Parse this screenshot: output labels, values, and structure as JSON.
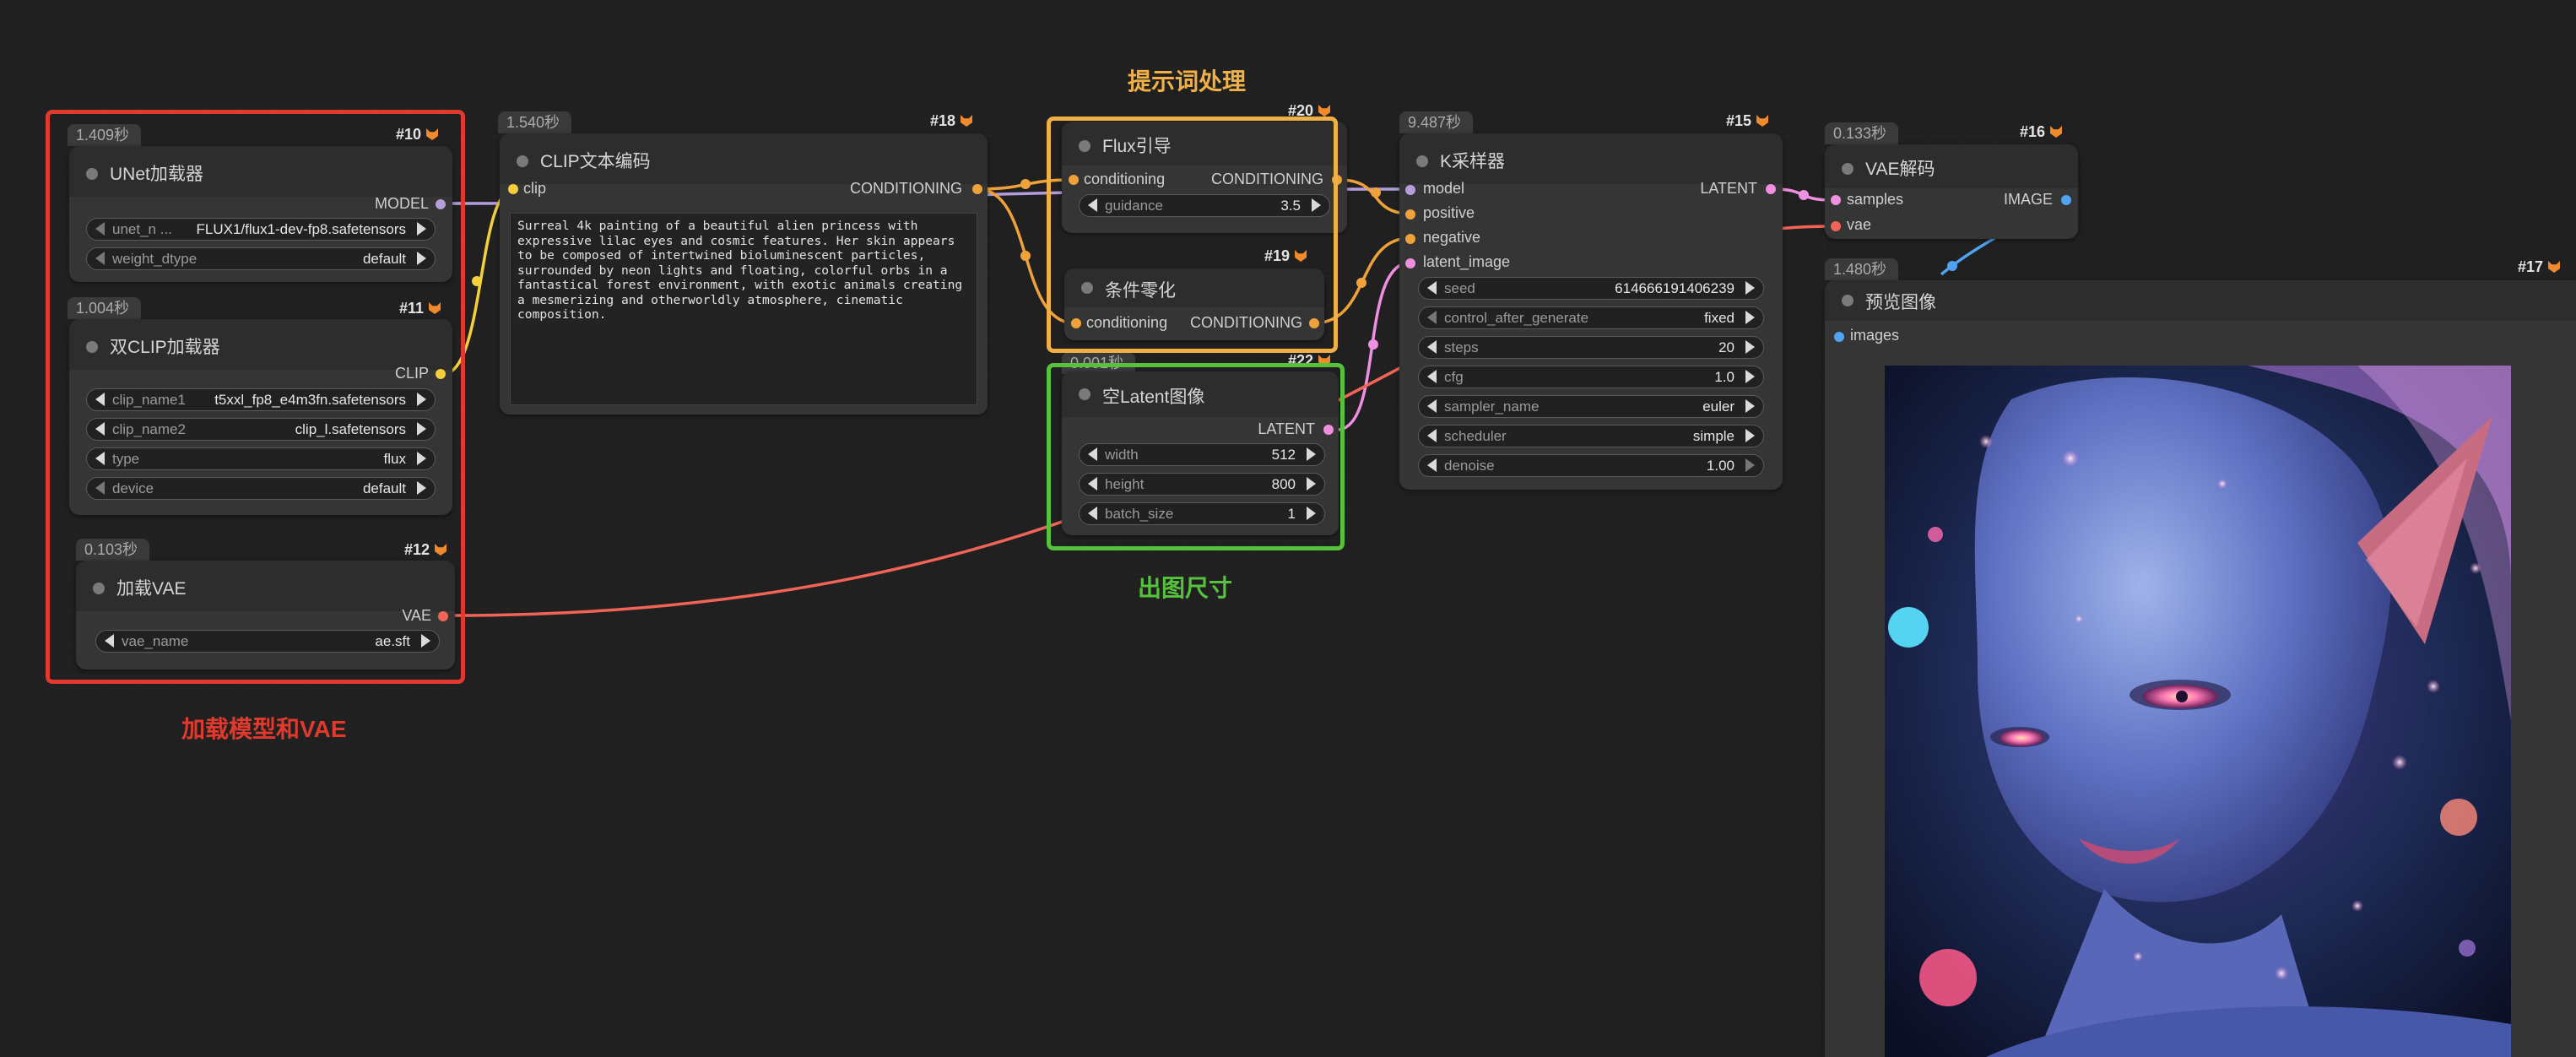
{
  "colors": {
    "canvas": "#202020",
    "node_body": "#353535",
    "node_title": "#2d2d2d",
    "group_red": "#e03a2f",
    "group_orange": "#f0b046",
    "group_green": "#56c23b",
    "wire_model": "#b39ddb",
    "wire_clip": "#f5cf3c",
    "wire_conditioning": "#f0a23a",
    "wire_vae": "#f26457",
    "wire_latent": "#ee8fe0",
    "wire_image": "#4fa3f0"
  },
  "groups": {
    "load_models": "加载模型和VAE",
    "prompt": "提示词处理",
    "size": "出图尺寸"
  },
  "nodes": {
    "unet": {
      "time": "1.409秒",
      "id": "#10",
      "title": "UNet加载器",
      "output": "MODEL",
      "widgets": [
        {
          "name": "unet_n ...",
          "value": "FLUX1/flux1-dev-fp8.safetensors"
        },
        {
          "name": "weight_dtype",
          "value": "default"
        }
      ]
    },
    "dual_clip": {
      "time": "1.004秒",
      "id": "#11",
      "title": "双CLIP加载器",
      "output": "CLIP",
      "widgets": [
        {
          "name": "clip_name1",
          "value": "t5xxl_fp8_e4m3fn.safetensors"
        },
        {
          "name": "clip_name2",
          "value": "clip_l.safetensors"
        },
        {
          "name": "type",
          "value": "flux"
        },
        {
          "name": "device",
          "value": "default"
        }
      ]
    },
    "vae_loader": {
      "time": "0.103秒",
      "id": "#12",
      "title": "加载VAE",
      "output": "VAE",
      "widgets": [
        {
          "name": "vae_name",
          "value": "ae.sft"
        }
      ]
    },
    "clip_encode": {
      "time": "1.540秒",
      "id": "#18",
      "title": "CLIP文本编码",
      "input": "clip",
      "output": "CONDITIONING",
      "text": "Surreal 4k painting of a beautiful alien princess with expressive lilac eyes and cosmic features. Her skin appears to be composed of intertwined bioluminescent particles, surrounded by neon lights and floating, colorful orbs in a fantastical forest environment, with exotic animals creating a mesmerizing and otherworldly atmosphere, cinematic composition."
    },
    "flux_guidance": {
      "id": "#20",
      "title": "Flux引导",
      "input": "conditioning",
      "output": "CONDITIONING",
      "widgets": [
        {
          "name": "guidance",
          "value": "3.5"
        }
      ]
    },
    "cond_zero": {
      "id": "#19",
      "title": "条件零化",
      "input": "conditioning",
      "output": "CONDITIONING"
    },
    "empty_latent": {
      "time": "0.001秒",
      "id": "#22",
      "title": "空Latent图像",
      "output": "LATENT",
      "widgets": [
        {
          "name": "width",
          "value": "512"
        },
        {
          "name": "height",
          "value": "800"
        },
        {
          "name": "batch_size",
          "value": "1"
        }
      ]
    },
    "ksampler": {
      "time": "9.487秒",
      "id": "#15",
      "title": "K采样器",
      "output": "LATENT",
      "inputs": [
        "model",
        "positive",
        "negative",
        "latent_image"
      ],
      "widgets": [
        {
          "name": "seed",
          "value": "614666191406239"
        },
        {
          "name": "control_after_generate",
          "value": "fixed"
        },
        {
          "name": "steps",
          "value": "20"
        },
        {
          "name": "cfg",
          "value": "1.0"
        },
        {
          "name": "sampler_name",
          "value": "euler"
        },
        {
          "name": "scheduler",
          "value": "simple"
        },
        {
          "name": "denoise",
          "value": "1.00"
        }
      ]
    },
    "vae_decode": {
      "time": "0.133秒",
      "id": "#16",
      "title": "VAE解码",
      "output": "IMAGE",
      "inputs": [
        "samples",
        "vae"
      ]
    },
    "preview": {
      "time": "1.480秒",
      "id": "#17",
      "title": "预览图像",
      "input": "images"
    }
  }
}
